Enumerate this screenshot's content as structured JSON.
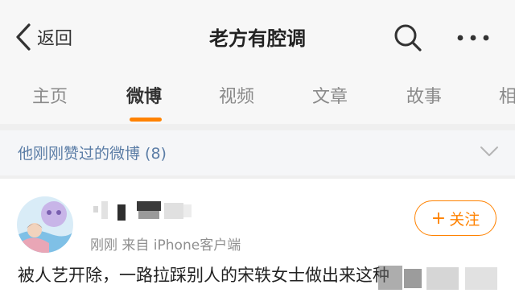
{
  "nav": {
    "back_label": "返回",
    "title": "老方有腔调",
    "back_icon": "chevron-left-icon",
    "search_icon": "search-icon",
    "more_icon": "more-icon"
  },
  "tabs": [
    {
      "label": "主页",
      "active": false
    },
    {
      "label": "微博",
      "active": true
    },
    {
      "label": "视频",
      "active": false
    },
    {
      "label": "文章",
      "active": false
    },
    {
      "label": "故事",
      "active": false
    },
    {
      "label": "相",
      "active": false
    }
  ],
  "liked_bar": {
    "text": "他刚刚赞过的微博 (8)",
    "icon": "chevron-down-icon"
  },
  "post": {
    "meta": "刚刚  来自 iPhone客户端",
    "follow_label": "关注",
    "follow_icon": "plus-icon",
    "body": "被人艺开除，一路拉踩别人的宋轶女士做出来这种"
  },
  "colors": {
    "accent": "#ff8200",
    "link": "#5b7da6",
    "header_bg": "#f7f7f7"
  }
}
